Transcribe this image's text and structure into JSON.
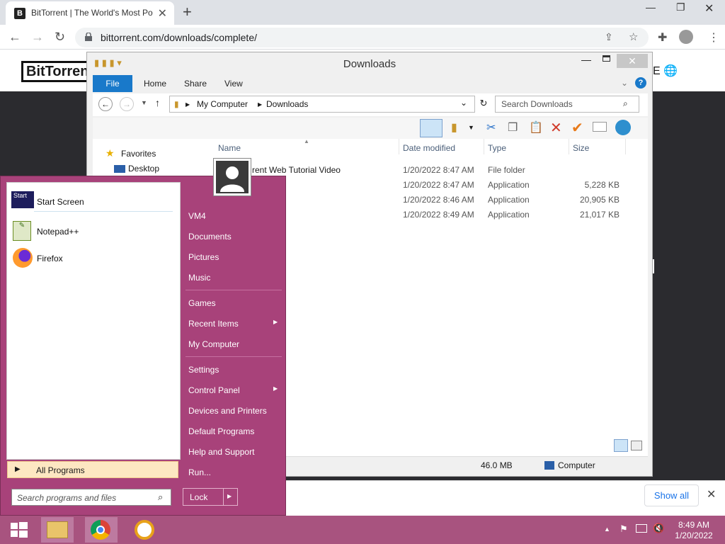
{
  "browser": {
    "tab_title": "BitTorrent | The World's Most Po",
    "favicon_letter": "B",
    "url": "bittorrent.com/downloads/complete/",
    "new_tab": "+",
    "tab_close": "✕"
  },
  "page": {
    "logo": "BitTorrent",
    "header_right": "E",
    "download_bar": {
      "show_all": "Show all"
    }
  },
  "explorer": {
    "title": "Downloads",
    "ribbon_tabs": [
      "File",
      "Home",
      "Share",
      "View"
    ],
    "breadcrumb": [
      "My Computer",
      "Downloads"
    ],
    "search_placeholder": "Search Downloads",
    "columns": [
      "Name",
      "Date modified",
      "Type",
      "Size"
    ],
    "nav": {
      "favorites": "Favorites",
      "desktop": "Desktop"
    },
    "files": [
      {
        "name": "rent Web Tutorial Video",
        "date": "1/20/2022 8:47 AM",
        "type": "File folder",
        "size": ""
      },
      {
        "name": "",
        "date": "1/20/2022 8:47 AM",
        "type": "Application",
        "size": "5,228 KB"
      },
      {
        "name": "",
        "date": "1/20/2022 8:46 AM",
        "type": "Application",
        "size": "20,905 KB"
      },
      {
        "name": "",
        "date": "1/20/2022 8:49 AM",
        "type": "Application",
        "size": "21,017 KB"
      }
    ],
    "status": {
      "size": "46.0 MB",
      "location": "Computer"
    }
  },
  "start_menu": {
    "pinned": [
      {
        "label": "Start Screen",
        "icon": "start-screen-icon"
      },
      {
        "label": "Notepad++",
        "icon": "notepadpp-icon"
      },
      {
        "label": "Firefox",
        "icon": "firefox-icon"
      }
    ],
    "all_programs": "All Programs",
    "search_placeholder": "Search programs and files",
    "right": {
      "vm4": "VM4",
      "documents": "Documents",
      "pictures": "Pictures",
      "music": "Music",
      "games": "Games",
      "recent": "Recent Items",
      "computer": "My Computer",
      "settings": "Settings",
      "control_panel": "Control Panel",
      "devices": "Devices and Printers",
      "defaults": "Default Programs",
      "help": "Help and Support",
      "run": "Run..."
    },
    "lock": "Lock",
    "start_screen_badge": "Start"
  },
  "taskbar": {
    "time": "8:49 AM",
    "date": "1/20/2022"
  }
}
